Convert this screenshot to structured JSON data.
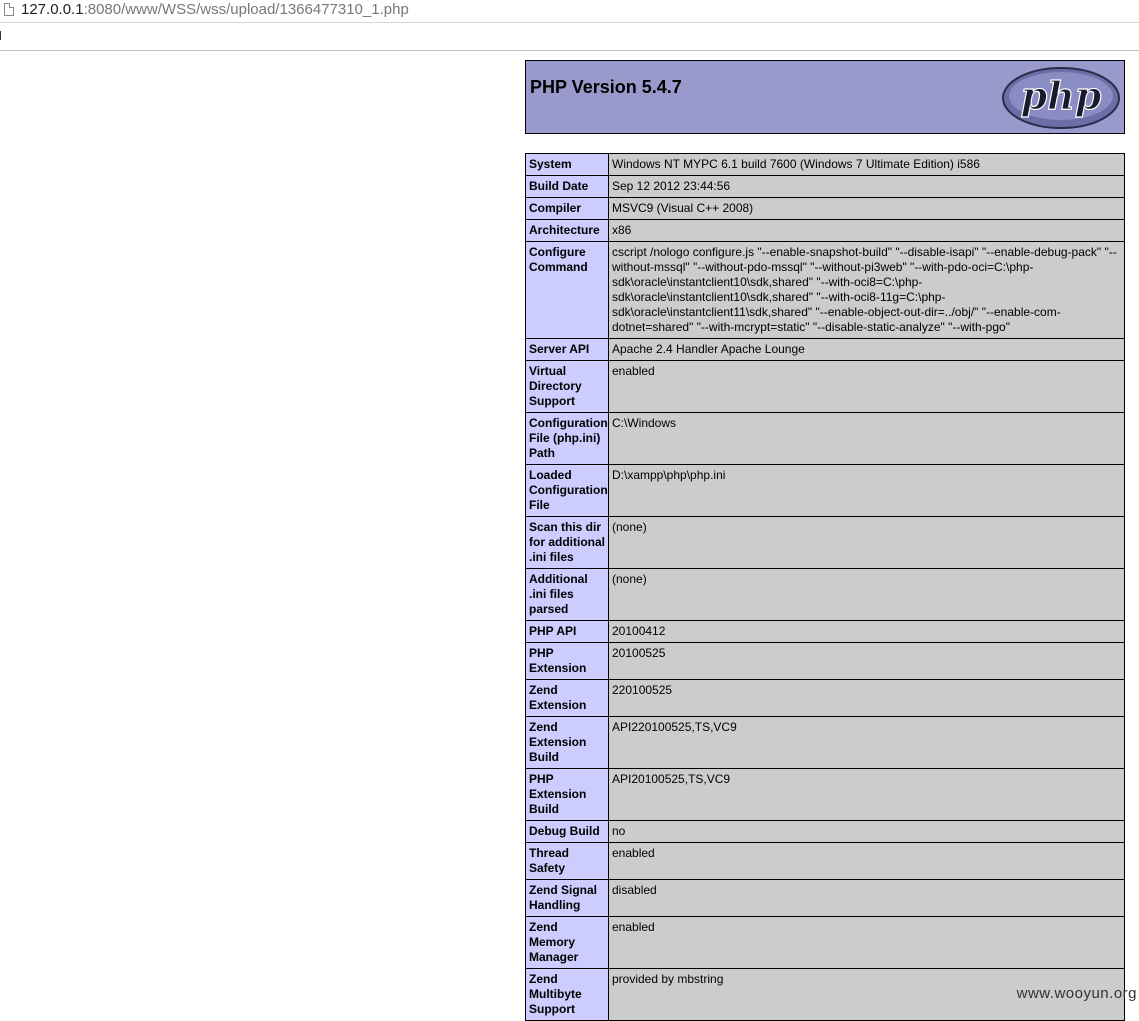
{
  "browser": {
    "url_host": "127.0.0.1",
    "url_rest": ":8080/www/WSS/wss/upload/1366477310_1.php",
    "icon": "page-icon"
  },
  "header": {
    "title": "PHP Version 5.4.7",
    "logo_text": "php"
  },
  "info_rows": [
    {
      "key": "System",
      "value": "Windows NT MYPC 6.1 build 7600 (Windows 7 Ultimate Edition) i586"
    },
    {
      "key": "Build Date",
      "value": "Sep 12 2012 23:44:56"
    },
    {
      "key": "Compiler",
      "value": "MSVC9 (Visual C++ 2008)"
    },
    {
      "key": "Architecture",
      "value": "x86"
    },
    {
      "key": "Configure Command",
      "value": "cscript /nologo configure.js \"--enable-snapshot-build\" \"--disable-isapi\" \"--enable-debug-pack\" \"--without-mssql\" \"--without-pdo-mssql\" \"--without-pi3web\" \"--with-pdo-oci=C:\\php-sdk\\oracle\\instantclient10\\sdk,shared\" \"--with-oci8=C:\\php-sdk\\oracle\\instantclient10\\sdk,shared\" \"--with-oci8-11g=C:\\php-sdk\\oracle\\instantclient11\\sdk,shared\" \"--enable-object-out-dir=../obj/\" \"--enable-com-dotnet=shared\" \"--with-mcrypt=static\" \"--disable-static-analyze\" \"--with-pgo\""
    },
    {
      "key": "Server API",
      "value": "Apache 2.4 Handler Apache Lounge"
    },
    {
      "key": "Virtual Directory Support",
      "value": "enabled"
    },
    {
      "key": "Configuration File (php.ini) Path",
      "value": "C:\\Windows"
    },
    {
      "key": "Loaded Configuration File",
      "value": "D:\\xampp\\php\\php.ini"
    },
    {
      "key": "Scan this dir for additional .ini files",
      "value": "(none)"
    },
    {
      "key": "Additional .ini files parsed",
      "value": "(none)"
    },
    {
      "key": "PHP API",
      "value": "20100412"
    },
    {
      "key": "PHP Extension",
      "value": "20100525"
    },
    {
      "key": "Zend Extension",
      "value": "220100525"
    },
    {
      "key": "Zend Extension Build",
      "value": "API220100525,TS,VC9"
    },
    {
      "key": "PHP Extension Build",
      "value": "API20100525,TS,VC9"
    },
    {
      "key": "Debug Build",
      "value": "no"
    },
    {
      "key": "Thread Safety",
      "value": "enabled"
    },
    {
      "key": "Zend Signal Handling",
      "value": "disabled"
    },
    {
      "key": "Zend Memory Manager",
      "value": "enabled"
    },
    {
      "key": "Zend Multibyte Support",
      "value": "provided by mbstring"
    }
  ],
  "watermark": "www.wooyun.org",
  "colors": {
    "header_bg": "#9999cc",
    "key_bg": "#ccccff",
    "value_bg": "#cccccc"
  }
}
